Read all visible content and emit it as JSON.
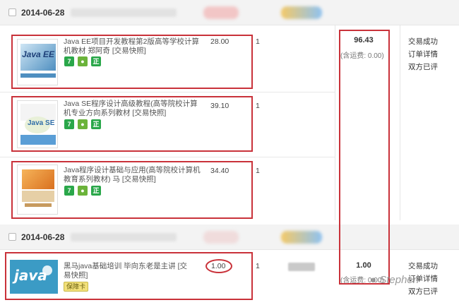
{
  "groups": [
    {
      "date": "2014-06-28"
    },
    {
      "date": "2014-06-28"
    }
  ],
  "items": [
    {
      "title": "Java EE项目开发教程第2版高等学校计算机教材 郑阿奇 [交易快照]",
      "price": "28.00",
      "qty": "1",
      "cover_text": "Java EE"
    },
    {
      "title": "Java SE程序设计高级教程(高等院校计算机专业方向系列教材 [交易快照]",
      "price": "39.10",
      "qty": "1",
      "cover_text": "Java SE"
    },
    {
      "title": "Java程序设计基础与应用(高等院校计算机教育系列教材) 马 [交易快照]",
      "price": "34.40",
      "qty": "1",
      "cover_text": ""
    },
    {
      "title": "黑马java基础培训 毕向东老是主讲 [交易快照]",
      "price": "1.00",
      "qty": "1",
      "cover_text": "java"
    }
  ],
  "badges": {
    "seven": "7",
    "zheng": "正",
    "guarantee": "保障卡"
  },
  "order1": {
    "total": "96.43",
    "shipping": "(含运费: 0.00)",
    "status": [
      "交易成功",
      "订单详情",
      "双方已评"
    ]
  },
  "order2": {
    "total": "1.00",
    "shipping": "(含运费: 0.00)",
    "status": [
      "交易成功",
      "订单详情",
      "双方已评"
    ]
  },
  "watermark": "Stephen",
  "colors": {
    "highlight": "#c9323a",
    "header_bg": "#f3f3f3",
    "badge_green": "#2aa74a"
  }
}
